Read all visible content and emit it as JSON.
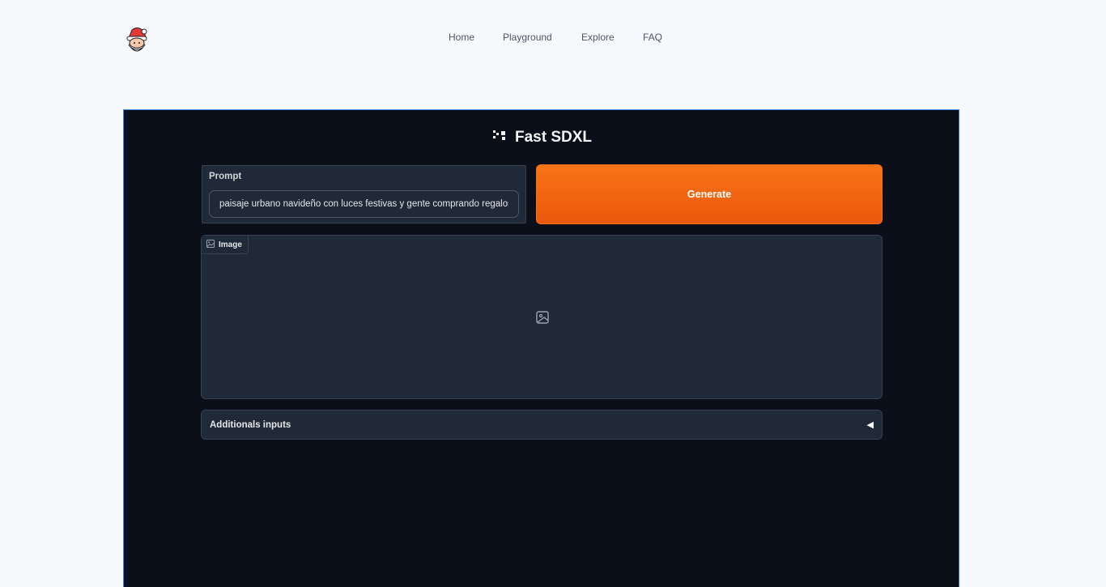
{
  "nav": {
    "items": [
      {
        "label": "Home"
      },
      {
        "label": "Playground"
      },
      {
        "label": "Explore"
      },
      {
        "label": "FAQ"
      }
    ]
  },
  "app": {
    "title": "Fast SDXL",
    "prompt": {
      "label": "Prompt",
      "value": "paisaje urbano navideño con luces festivas y gente comprando regalos."
    },
    "generate_label": "Generate",
    "image_label": "Image",
    "accordion_label": "Additionals inputs",
    "accordion_arrow": "◀"
  },
  "colors": {
    "accent": "#f97316",
    "panel": "#1f2937",
    "app_bg": "#0b0f19",
    "page_bg": "#f7f9fc"
  },
  "icons": [
    "santa-logo-icon",
    "sparkle-icon",
    "image-icon",
    "image-placeholder-icon",
    "caret-left-icon"
  ]
}
